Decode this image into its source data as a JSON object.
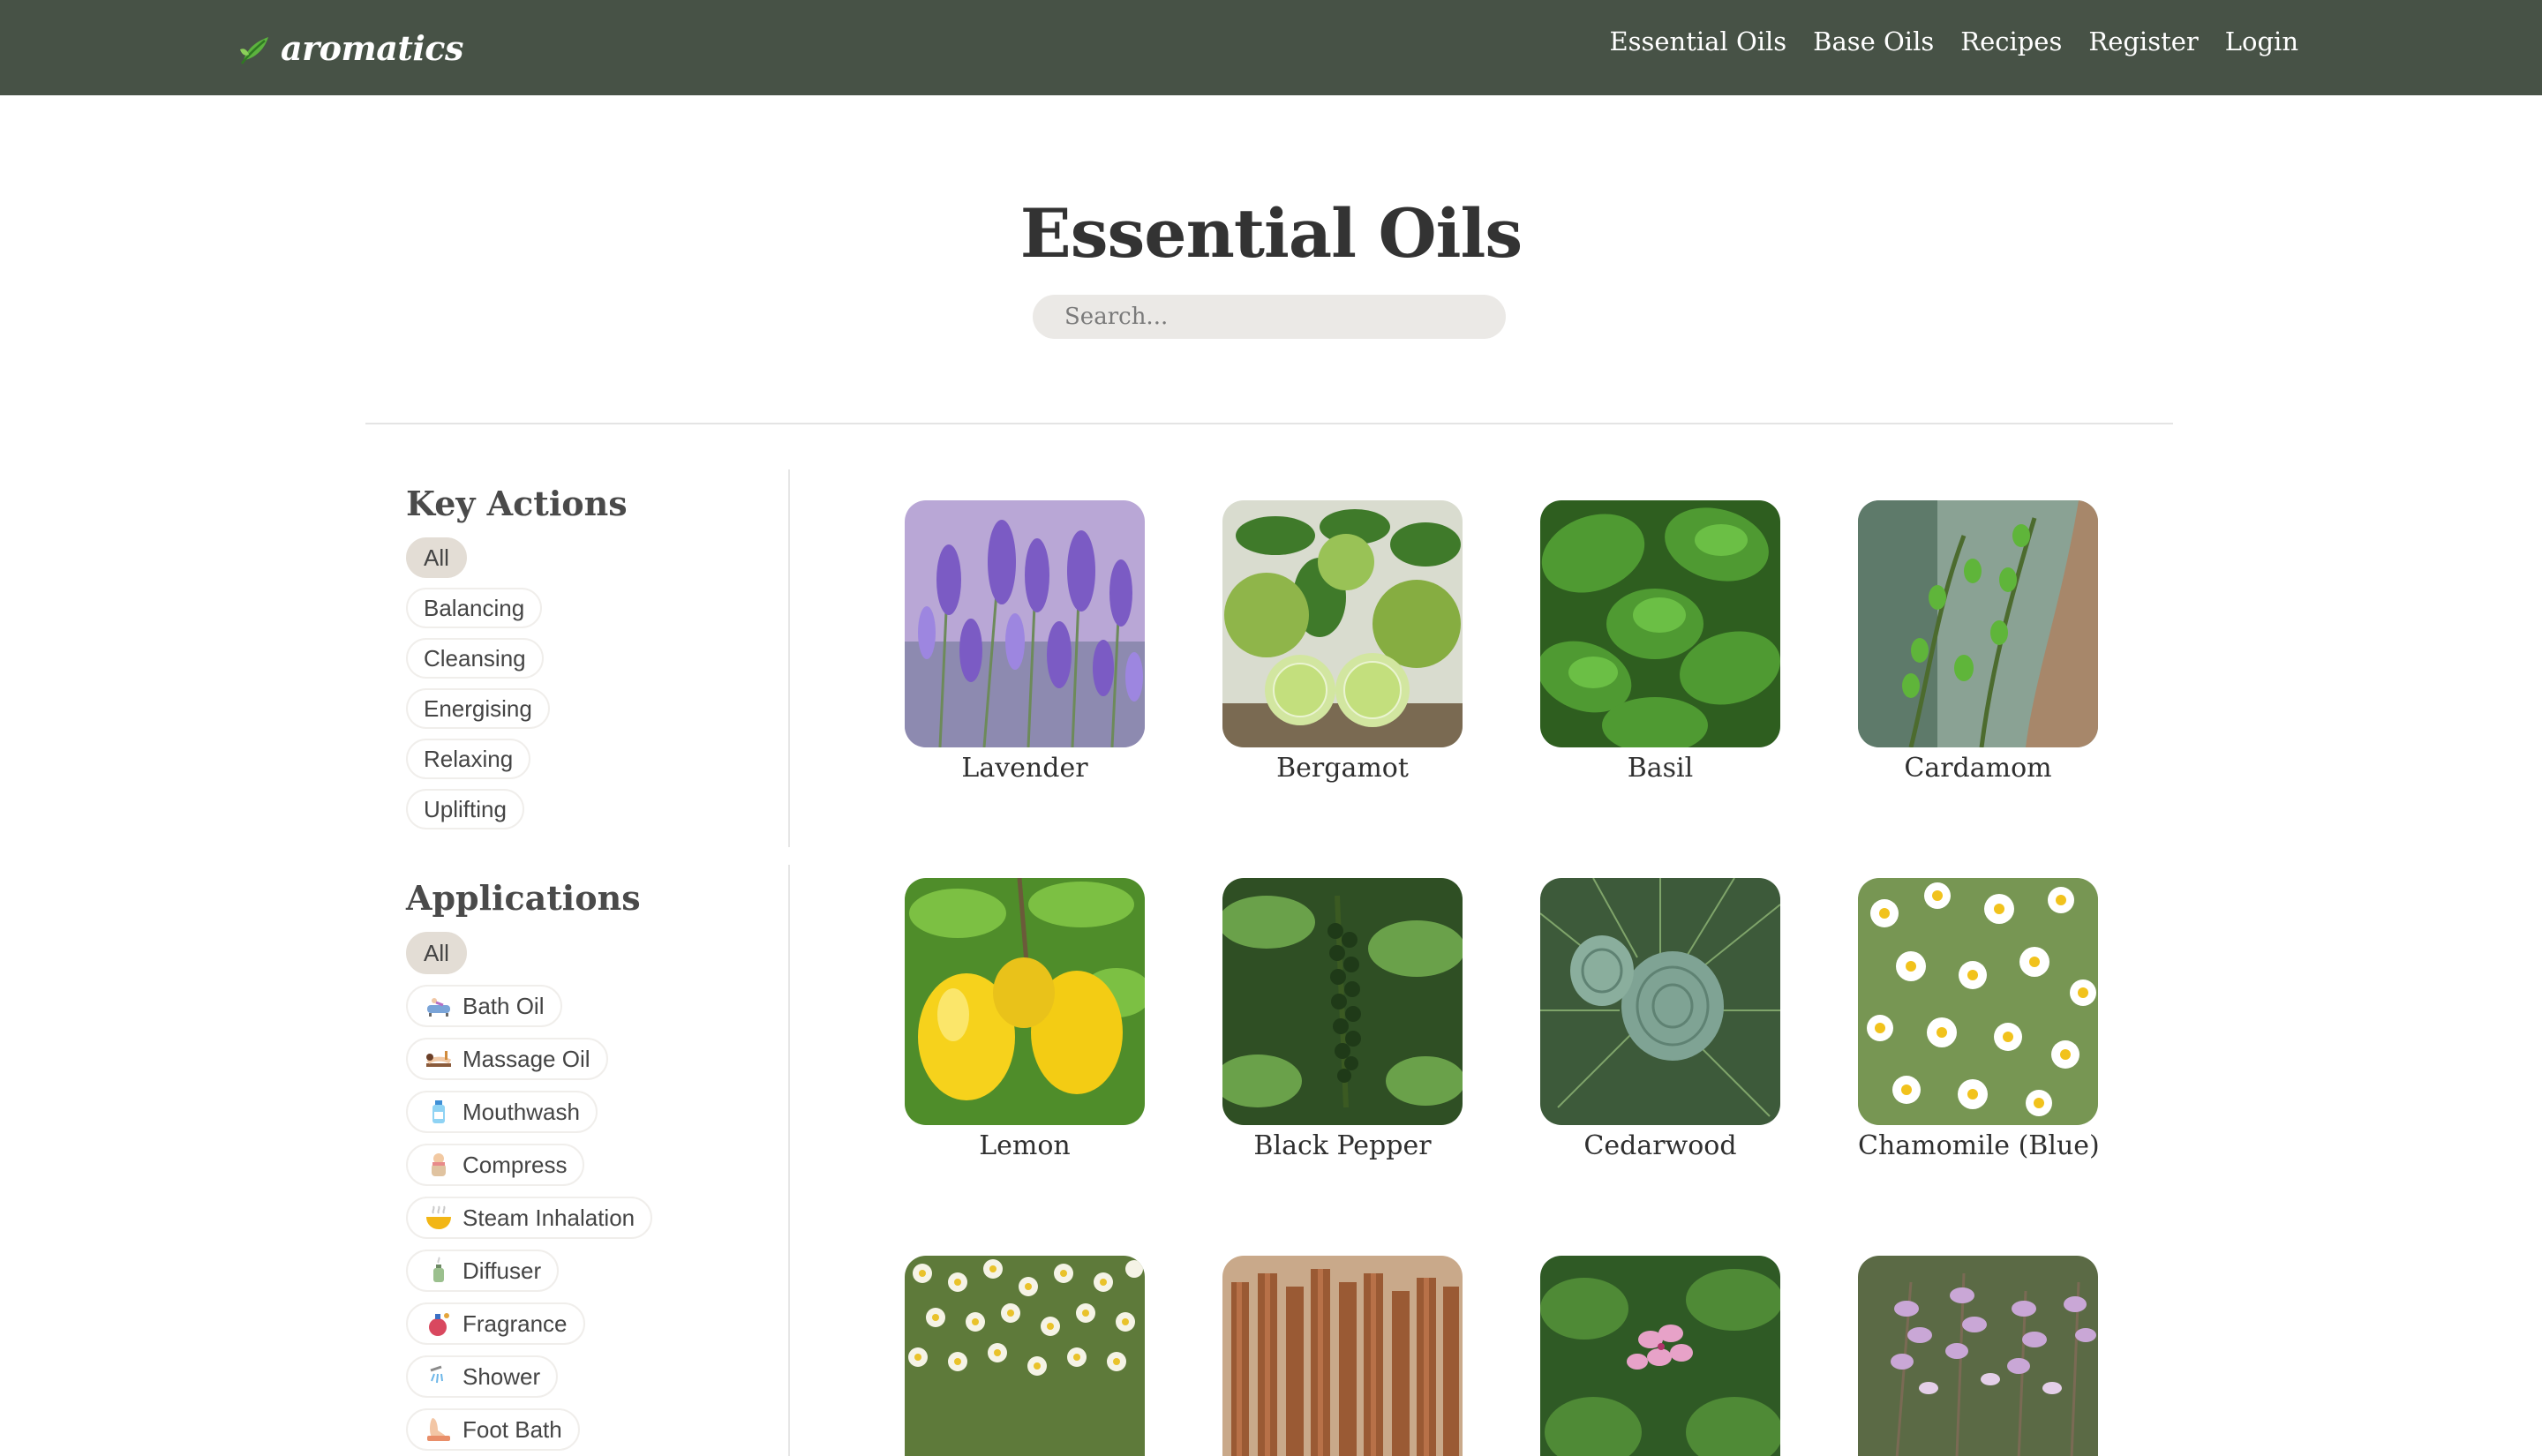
{
  "brand": {
    "name": "aromatics",
    "accent": "#4fa63a"
  },
  "nav": {
    "background": "#475246",
    "links": [
      "Essential Oils",
      "Base Oils",
      "Recipes",
      "Register",
      "Login"
    ]
  },
  "hero": {
    "title": "Essential Oils",
    "search_placeholder": "Search..."
  },
  "sidebar": {
    "key_actions": {
      "heading": "Key Actions",
      "items": [
        "All",
        "Balancing",
        "Cleansing",
        "Energising",
        "Relaxing",
        "Uplifting"
      ],
      "selected": "All"
    },
    "applications": {
      "heading": "Applications",
      "items": [
        {
          "label": "All",
          "icon": ""
        },
        {
          "label": "Bath Oil",
          "icon": "bathtub-icon"
        },
        {
          "label": "Massage Oil",
          "icon": "massage-icon"
        },
        {
          "label": "Mouthwash",
          "icon": "mouthwash-bottle-icon"
        },
        {
          "label": "Compress",
          "icon": "compress-icon"
        },
        {
          "label": "Steam Inhalation",
          "icon": "steam-bowl-icon"
        },
        {
          "label": "Diffuser",
          "icon": "diffuser-icon"
        },
        {
          "label": "Fragrance",
          "icon": "perfume-bottle-icon"
        },
        {
          "label": "Shower",
          "icon": "shower-icon"
        },
        {
          "label": "Foot Bath",
          "icon": "foot-bath-icon"
        }
      ],
      "selected": "All"
    }
  },
  "oils": [
    {
      "name": "Lavender",
      "image": "lavender-photo"
    },
    {
      "name": "Bergamot",
      "image": "bergamot-photo"
    },
    {
      "name": "Basil",
      "image": "basil-photo"
    },
    {
      "name": "Cardamom",
      "image": "cardamom-photo"
    },
    {
      "name": "Lemon",
      "image": "lemon-photo"
    },
    {
      "name": "Black Pepper",
      "image": "black-pepper-photo"
    },
    {
      "name": "Cedarwood",
      "image": "cedarwood-photo"
    },
    {
      "name": "Chamomile (Blue)",
      "image": "chamomile-blue-photo"
    },
    {
      "name": "",
      "image": "chamomile-flowers-photo"
    },
    {
      "name": "",
      "image": "cinnamon-sticks-photo"
    },
    {
      "name": "",
      "image": "geranium-photo"
    },
    {
      "name": "",
      "image": "clary-sage-photo"
    }
  ]
}
